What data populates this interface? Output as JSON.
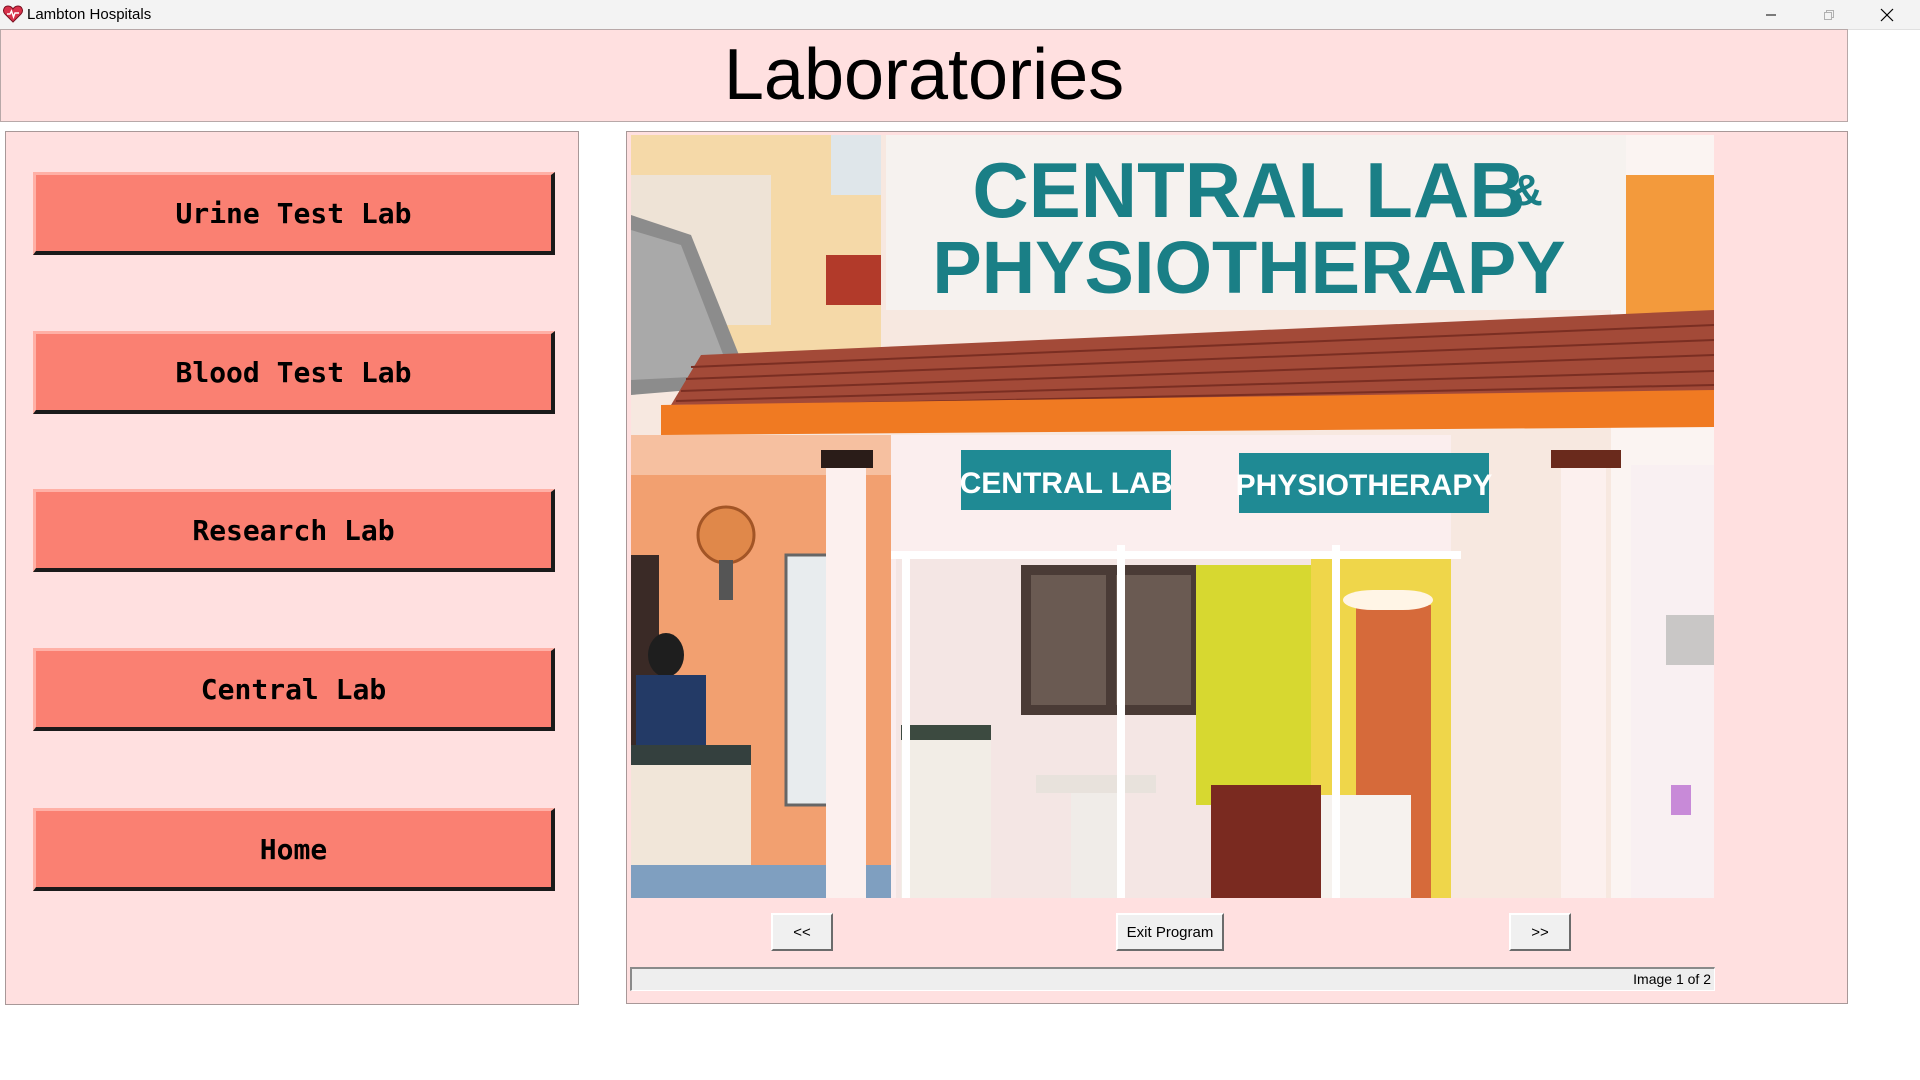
{
  "window": {
    "title": "Lambton Hospitals",
    "icon": "heart-icon",
    "controls": [
      "minimize-icon",
      "maximize-icon",
      "close-icon"
    ]
  },
  "header": {
    "title": "Laboratories"
  },
  "sidebar": {
    "buttons": [
      {
        "label": "Urine Test Lab"
      },
      {
        "label": "Blood Test Lab"
      },
      {
        "label": "Research Lab"
      },
      {
        "label": "Central Lab"
      },
      {
        "label": "Home"
      }
    ]
  },
  "viewer": {
    "image": {
      "sign_main_line1": "CENTRAL LAB",
      "sign_main_amp": "&",
      "sign_main_line2": "PHYSIOTHERAPY",
      "sign_left": "CENTRAL LAB",
      "sign_right": "PHYSIOTHERAPY"
    },
    "prev_label": "<<",
    "exit_label": "Exit Program",
    "next_label": ">>",
    "status": "Image 1 of 2"
  },
  "colors": {
    "panel_background": "#ffe0e0",
    "button_salmon": "#fa8072",
    "sign_teal": "#1a7f86"
  }
}
